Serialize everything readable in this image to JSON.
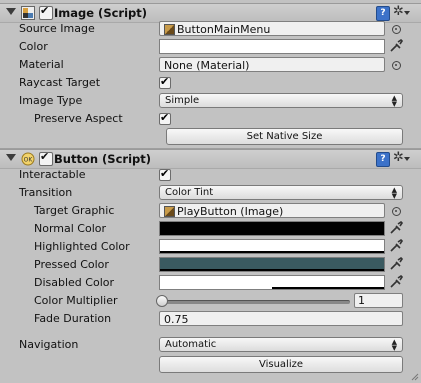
{
  "image_component": {
    "title": "Image (Script)",
    "help_icon": "help-book-icon",
    "gear_icon": "gear-icon",
    "source_image": {
      "label": "Source Image",
      "value": "ButtonMainMenu"
    },
    "color": {
      "label": "Color",
      "value": "#ffffff"
    },
    "material": {
      "label": "Material",
      "value": "None (Material)"
    },
    "raycast_target": {
      "label": "Raycast Target",
      "checked": true
    },
    "image_type": {
      "label": "Image Type",
      "value": "Simple"
    },
    "preserve_aspect": {
      "label": "Preserve Aspect",
      "checked": true
    },
    "set_native_size": "Set Native Size"
  },
  "button_component": {
    "title": "Button (Script)",
    "interactable": {
      "label": "Interactable",
      "checked": true
    },
    "transition": {
      "label": "Transition",
      "value": "Color Tint"
    },
    "target_graphic": {
      "label": "Target Graphic",
      "value": "PlayButton (Image)"
    },
    "normal_color": {
      "label": "Normal Color",
      "value": "#000000"
    },
    "highlighted_color": {
      "label": "Highlighted Color",
      "value": "#ffffff"
    },
    "pressed_color": {
      "label": "Pressed Color",
      "value": "#3a5a60"
    },
    "disabled_color": {
      "label": "Disabled Color",
      "value": "#ffffff",
      "alpha": 0.5
    },
    "color_multiplier": {
      "label": "Color Multiplier",
      "value": "1",
      "slider_fraction": 0.0,
      "range": [
        1,
        5
      ]
    },
    "fade_duration": {
      "label": "Fade Duration",
      "value": "0.75"
    },
    "navigation": {
      "label": "Navigation",
      "value": "Automatic"
    },
    "visualize": "Visualize"
  }
}
